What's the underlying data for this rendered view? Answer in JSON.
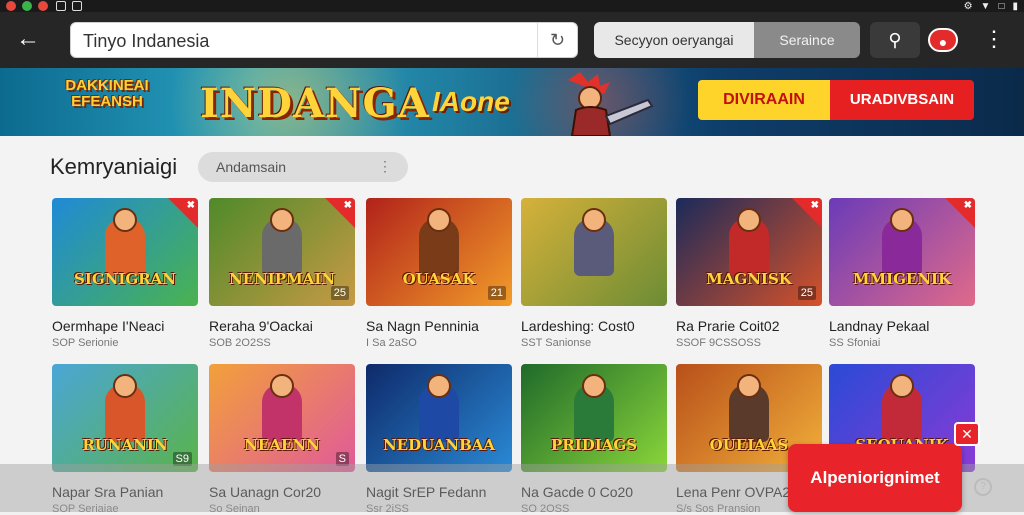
{
  "statusbar": {
    "icons": [
      "record-icon",
      "wifi-icon",
      "window-icon",
      "settings-icon",
      "battery-icon"
    ]
  },
  "toolbar": {
    "back_icon": "arrow-left-icon",
    "url": "Tinyo Indanesia",
    "reload_icon": "reload-icon",
    "segment_left": "Secyyon oeryangai",
    "segment_right": "Seraince",
    "search_icon": "search-icon",
    "menu_icon": "kebab-icon"
  },
  "banner": {
    "logo_left": "DAKKINEAI EFEANSH",
    "logo_main": "INDANGA",
    "logo_right": "IAone",
    "button_yellow": "DIVIRAAIN",
    "button_red": "URADIVBSAIN"
  },
  "section": {
    "title": "Kemryaniaigi",
    "filter_placeholder": "Andamsain",
    "filter_icon": "more-vertical-icon"
  },
  "rows": [
    [
      {
        "title": "Oermhape I'Neaci",
        "sub": "SOP Serionie",
        "art": "SIGNIGRAN",
        "colors": [
          "#1f8ad6",
          "#4ab34f"
        ],
        "figure": "#e0622b",
        "ribbon": true,
        "tag": ""
      },
      {
        "title": "Reraha 9'Oackai",
        "sub": "SOB 2O2SS",
        "art": "NENIPMAIN",
        "colors": [
          "#4f8a2a",
          "#c79a45"
        ],
        "figure": "#6a6a6a",
        "ribbon": true,
        "tag": "25"
      },
      {
        "title": "Sa Nagn Penninia",
        "sub": "I Sa 2aSO",
        "art": "OUASAK",
        "colors": [
          "#b1221a",
          "#f29c2a"
        ],
        "figure": "#7a3b19",
        "ribbon": false,
        "tag": "21"
      },
      {
        "title": "Lardeshing: Cost0",
        "sub": "SST Sanionse",
        "art": "",
        "colors": [
          "#d6b13a",
          "#6c8c35"
        ],
        "figure": "#5a5a7a",
        "ribbon": false,
        "tag": ""
      },
      {
        "title": "Ra Prarie Coit02",
        "sub": "SSOF 9CSSOSS",
        "art": "MAGNISK",
        "colors": [
          "#1b2a5a",
          "#d6522a"
        ],
        "figure": "#c22a2a",
        "ribbon": true,
        "tag": "25"
      },
      {
        "title": "Landnay Pekaal",
        "sub": "SS Sfoniai",
        "art": "MMIGENIK",
        "colors": [
          "#6a3bb8",
          "#e06a8a"
        ],
        "figure": "#8a2a9a",
        "ribbon": true,
        "tag": ""
      }
    ],
    [
      {
        "title": "Napar Sra Panian",
        "sub": "SOP Seriaiae",
        "art": "RUNANIN",
        "colors": [
          "#4aa6d6",
          "#5ab34a"
        ],
        "figure": "#d8562a",
        "ribbon": false,
        "tag": "S9"
      },
      {
        "title": "Sa Uanagn Cor20",
        "sub": "So Seinan",
        "art": "NEAENN",
        "colors": [
          "#f2a03a",
          "#e05a9a"
        ],
        "figure": "#c2336a",
        "ribbon": false,
        "tag": "S"
      },
      {
        "title": "Nagit SrEP Fedann",
        "sub": "Ssr 2iSS",
        "art": "NEDUANBAA",
        "colors": [
          "#0e2a6a",
          "#2a8ad6"
        ],
        "figure": "#1e4aa6",
        "ribbon": false,
        "tag": ""
      },
      {
        "title": "Na Gacde 0 Co20",
        "sub": "SO 2OSS",
        "art": "PRIDIAGS",
        "colors": [
          "#1f6a2a",
          "#8ad63a"
        ],
        "figure": "#2a7a3a",
        "ribbon": false,
        "tag": ""
      },
      {
        "title": "Lena Penr OVPA2",
        "sub": "S/s Sos Pransion",
        "art": "OUEIAAS",
        "colors": [
          "#b8501a",
          "#f2b03a"
        ],
        "figure": "#5a3a2a",
        "ribbon": false,
        "tag": ""
      },
      {
        "title": "",
        "sub": "",
        "art": "SEOUANIK",
        "colors": [
          "#2a4ad6",
          "#8a3bd6"
        ],
        "figure": "#c22a3a",
        "ribbon": false,
        "tag": ""
      }
    ]
  ],
  "cta": {
    "label": "Alpeniorignimet",
    "close_icon": "close-icon",
    "help_icon": "help-icon"
  }
}
